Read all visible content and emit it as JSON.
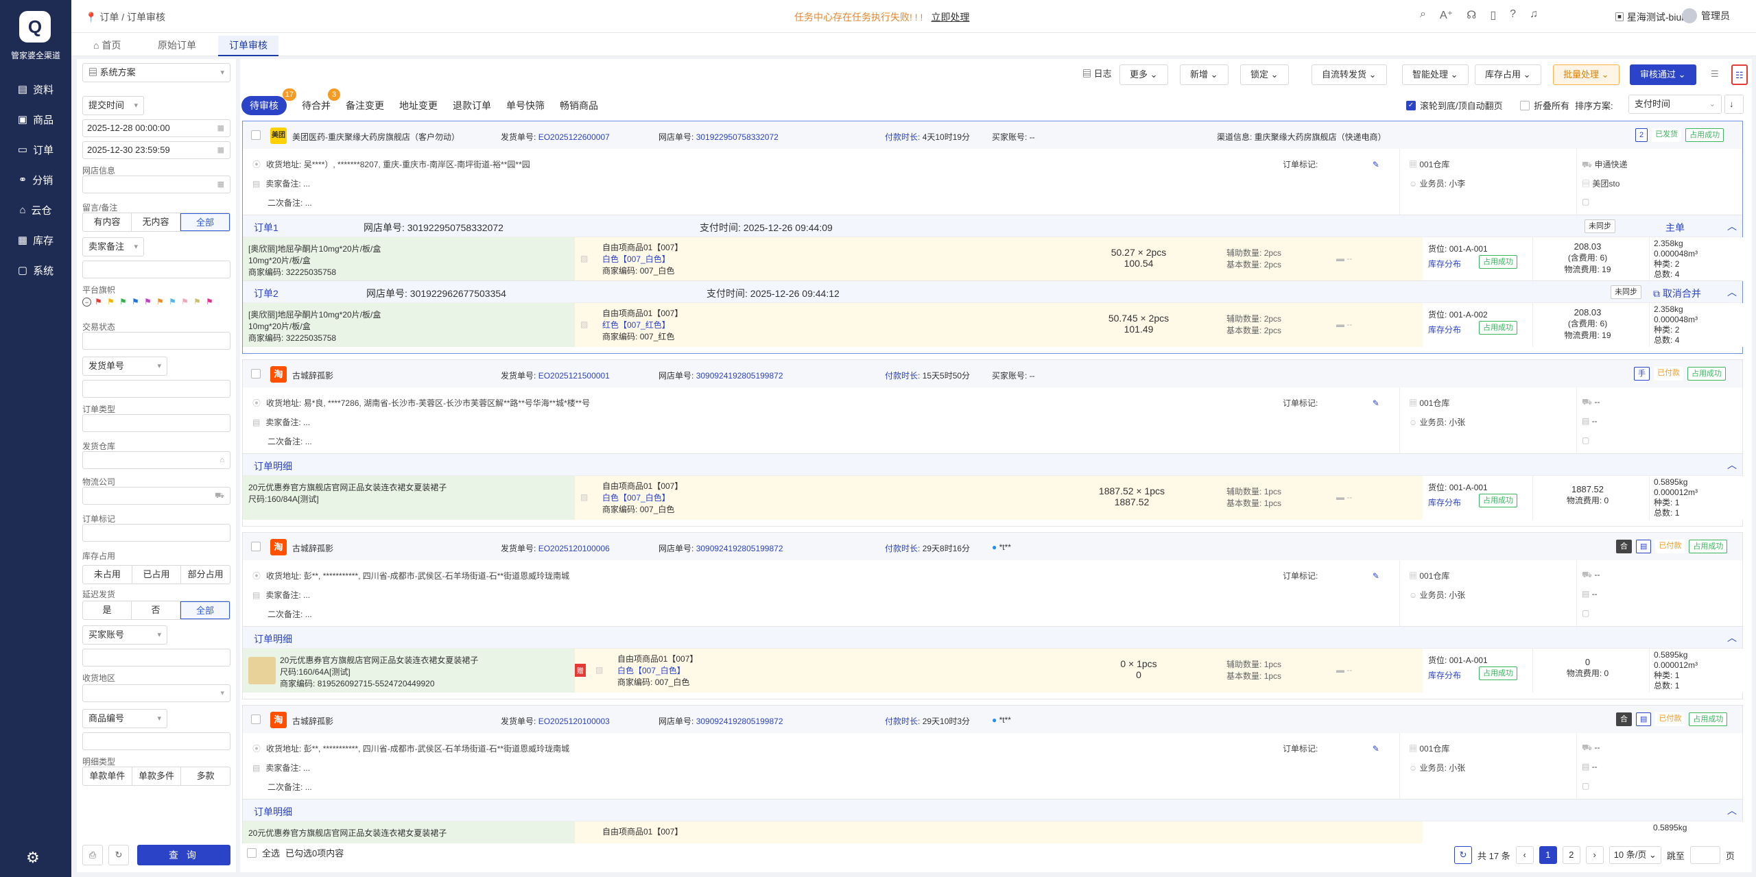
{
  "app": {
    "name": "管家婆全渠道",
    "logo_glyph": "Q"
  },
  "nav": [
    {
      "label": "资料",
      "icon": "data-icon"
    },
    {
      "label": "商品",
      "icon": "goods-icon"
    },
    {
      "label": "订单",
      "icon": "order-icon"
    },
    {
      "label": "分销",
      "icon": "distribution-icon"
    },
    {
      "label": "云仓",
      "icon": "cloud-warehouse-icon"
    },
    {
      "label": "库存",
      "icon": "inventory-icon"
    },
    {
      "label": "系统",
      "icon": "system-icon"
    }
  ],
  "header": {
    "breadcrumb": "订单 / 订单审核",
    "warning": "任务中心存在任务执行失败! ! !",
    "warning_link": "立即处理",
    "shop": "星海测试-biubiu",
    "user": "管理员"
  },
  "page_tabs": [
    "首页",
    "原始订单",
    "订单审核"
  ],
  "filter": {
    "scheme": "系统方案",
    "time_type": "提交时间",
    "start": "2025-12-28 00:00:00",
    "end": "2025-12-30 23:59:59",
    "shop_label": "网店信息",
    "msg_label": "留言/备注",
    "msg_options": [
      "有内容",
      "无内容",
      "全部"
    ],
    "seller_note": "卖家备注",
    "flag_label": "平台旗帜",
    "status_label": "交易状态",
    "ship_no": "发货单号",
    "order_type": "订单类型",
    "warehouse": "发货仓库",
    "logistics": "物流公司",
    "order_mark": "订单标记",
    "stock_label": "库存占用",
    "stock_options": [
      "未占用",
      "已占用",
      "部分占用"
    ],
    "delay_label": "延迟发货",
    "delay_options": [
      "是",
      "否",
      "全部"
    ],
    "buyer": "买家账号",
    "region": "收货地区",
    "goods_no": "商品编号",
    "detail_label": "明细类型",
    "detail_options": [
      "单款单件",
      "单款多件",
      "多款"
    ],
    "query": "查 询"
  },
  "toolbar": {
    "log": "日志",
    "more": "更多",
    "add": "新增",
    "lock": "锁定",
    "auto": "自流转发货",
    "smart": "智能处理",
    "stock": "库存占用",
    "batch": "批量处理",
    "approve": "审核通过"
  },
  "subtabs": [
    {
      "label": "待审核",
      "badge": "17"
    },
    {
      "label": "待合并",
      "badge": "3"
    },
    {
      "label": "备注变更",
      "badge": ""
    },
    {
      "label": "地址变更",
      "badge": ""
    },
    {
      "label": "退款订单",
      "badge": ""
    },
    {
      "label": "单号快筛",
      "badge": ""
    },
    {
      "label": "畅销商品",
      "badge": ""
    }
  ],
  "options": {
    "scroll": "滚轮到底/顶自动翻页",
    "fold": "折叠所有",
    "sort_label": "排序方案:",
    "sort_value": "支付时间"
  },
  "labels": {
    "ship_no": "发货单号:",
    "web_no": "网店单号:",
    "pay_dur": "付款时长:",
    "buyer": "买家账号:",
    "addr": "收货地址:",
    "seller": "卖家备注:",
    "second": "二次备注:",
    "mark": "订单标记:",
    "clerk": "业务员:",
    "aux": "辅助数量:",
    "base": "基本数量:",
    "loc": "货位:",
    "stock_dist": "库存分布",
    "occupied": "占用成功",
    "barcode": "商家编码:",
    "detail": "订单明细",
    "pay_time": "支付时间:",
    "fee": "物流费用:",
    "kinds": "种类:",
    "total": "总数:",
    "inc": "(含费用:",
    "unsync": "未同步",
    "main": "主单",
    "cancel": "取消合并"
  },
  "orders": [
    {
      "shop": "美团医药-重庆聚缘大药房旗舰店（客户勿动）",
      "icon": "美团",
      "ship": "EO2025122600007",
      "web": "301922950758332072",
      "dur": "4天10时19分",
      "buyer": "--",
      "channel": "渠道信息: 重庆聚缘大药房旗舰店（快递电商）",
      "count": "2",
      "status": "已发货",
      "occ": "占用成功",
      "addr": "吴****）, *******8207, 重庆-重庆市-南岸区-南坪街道-裕**园**园",
      "seller": "...",
      "second": "...",
      "wh": "001仓库",
      "clerk": "小李",
      "log1": "申通快递",
      "log2": "美团sto",
      "subs": [
        {
          "title": "订单1",
          "web": "301922950758332072",
          "pay": "2025-12-26 09:44:09",
          "sync": "未同步",
          "act": "主单",
          "g1": "[奥欣丽]地屈孕酮片10mg*20片/板/盒",
          "g2": "10mg*20片/板/盒",
          "code": "32225035758",
          "item": "自由项商品01【007】",
          "sku": "白色【007_白色】",
          "icode": "007_白色",
          "qty": "50.27 × 2pcs",
          "amt": "100.54",
          "aux": "2pcs",
          "base": "2pcs",
          "loc": "001-A-001",
          "price": "208.03",
          "inc": "6",
          "fee": "19",
          "w": "2.358kg",
          "v": "0.000048m³",
          "k": "2",
          "t": "4"
        },
        {
          "title": "订单2",
          "web": "301922962677503354",
          "pay": "2025-12-26 09:44:12",
          "sync": "未同步",
          "act": "取消合并",
          "g1": "[奥欣丽]地屈孕酮片10mg*20片/板/盒",
          "g2": "10mg*20片/板/盒",
          "code": "32225035758",
          "item": "自由项商品01【007】",
          "sku": "红色【007_红色】",
          "icode": "007_红色",
          "qty": "50.745 × 2pcs",
          "amt": "101.49",
          "aux": "2pcs",
          "base": "2pcs",
          "loc": "001-A-002",
          "price": "208.03",
          "inc": "6",
          "fee": "19",
          "w": "2.358kg",
          "v": "0.000048m³",
          "k": "2",
          "t": "4"
        }
      ]
    },
    {
      "shop": "古城辞孤影",
      "icon": "淘",
      "ship": "EO2025121500001",
      "web": "3090924192805199872",
      "dur": "15天5时50分",
      "buyer": "--",
      "count": "手",
      "status": "已付款",
      "occ": "占用成功",
      "addr": "易*良, ****7286, 湖南省-长沙市-芙蓉区-长沙市芙蓉区解**路**号华海**城*楼**号",
      "seller": "...",
      "second": "...",
      "wh": "001仓库",
      "clerk": "小张",
      "log1": "--",
      "log2": "--",
      "d": {
        "g1": "20元优惠券官方旗舰店官网正品女装连衣裙女夏装裙子",
        "g2": "尺码:160/84A[测试]",
        "item": "自由项商品01【007】",
        "sku": "白色【007_白色】",
        "icode": "007_白色",
        "qty": "1887.52 × 1pcs",
        "amt": "1887.52",
        "aux": "1pcs",
        "base": "1pcs",
        "loc": "001-A-001",
        "price": "1887.52",
        "fee": "0",
        "w": "0.5895kg",
        "v": "0.000012m³",
        "k": "1",
        "t": "1"
      }
    },
    {
      "shop": "古城辞孤影",
      "icon": "淘",
      "ship": "EO2025120100006",
      "web": "3090924192805199872",
      "dur": "29天8时16分",
      "buyer": "*t**",
      "status": "已付款",
      "occ": "占用成功",
      "addr": "彭**, ***********, 四川省-成都市-武侯区-石羊场街道-石**街道恩威玲珑南城",
      "seller": "...",
      "second": "...",
      "wh": "001仓库",
      "clerk": "小张",
      "log1": "--",
      "log2": "--",
      "d": {
        "g1": "20元优惠券官方旗舰店官网正品女装连衣裙女夏装裙子",
        "g2": "尺码:160/64A[测试]",
        "code": "819526092715-5524720449920",
        "item": "自由项商品01【007】",
        "sku": "白色【007_白色】",
        "icode": "007_白色",
        "qty": "0 × 1pcs",
        "amt": "0",
        "aux": "1pcs",
        "base": "1pcs",
        "loc": "001-A-001",
        "price": "0",
        "fee": "0",
        "w": "0.5895kg",
        "v": "0.000012m³",
        "k": "1",
        "t": "1"
      }
    },
    {
      "shop": "古城辞孤影",
      "icon": "淘",
      "ship": "EO2025120100003",
      "web": "3090924192805199872",
      "dur": "29天10时3分",
      "buyer": "*t**",
      "status": "已付款",
      "occ": "占用成功",
      "addr": "彭**, ***********, 四川省-成都市-武侯区-石羊场街道-石**街道恩威玲珑南城",
      "seller": "...",
      "second": "...",
      "wh": "001仓库",
      "clerk": "小张",
      "log1": "--",
      "log2": "--",
      "d": {
        "g1": "20元优惠券官方旗舰店官网正品女装连衣裙女夏装裙子",
        "item": "自由项商品01【007】",
        "w": "0.5895kg"
      }
    }
  ],
  "footer": {
    "select_all": "全选",
    "selected": "已勾选0项内容",
    "total": "共 17 条",
    "pages": [
      "1",
      "2"
    ],
    "page_size": "10 条/页",
    "jump": "跳至",
    "page_unit": "页"
  }
}
